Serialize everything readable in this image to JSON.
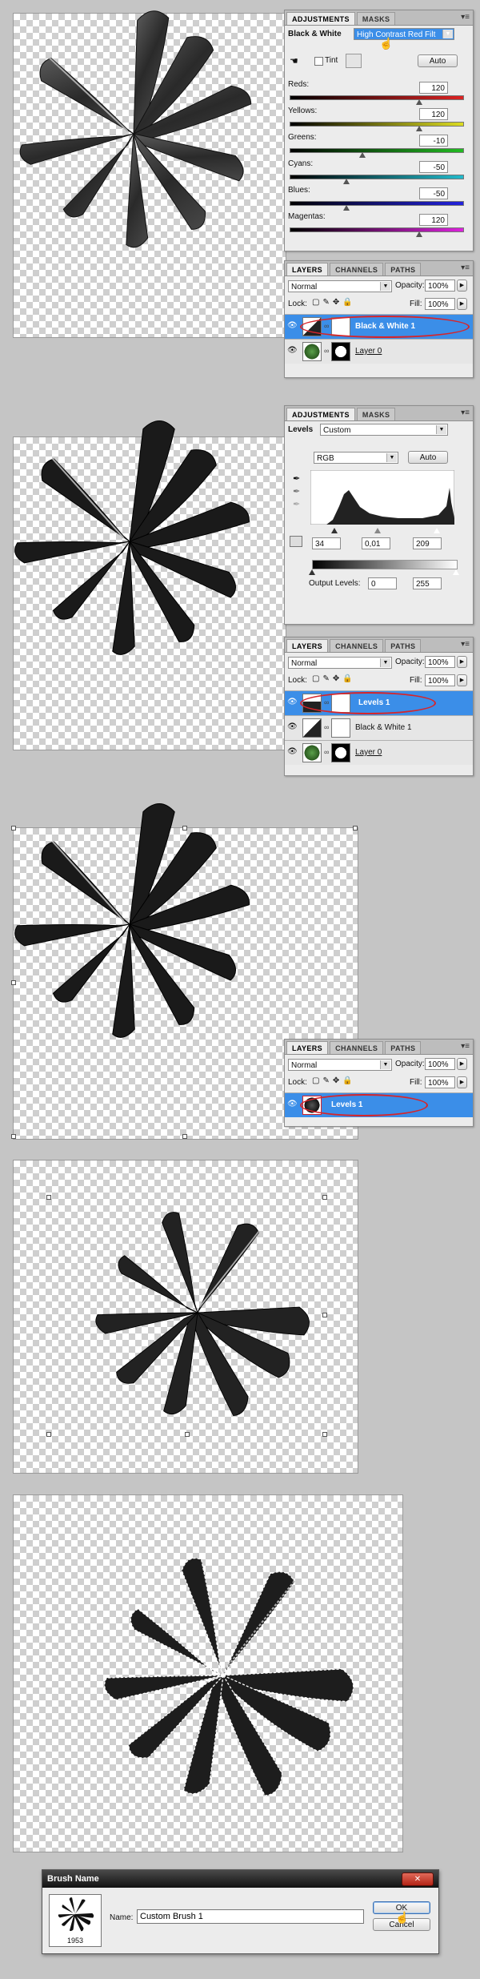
{
  "step1": {
    "adjust_tabs": [
      "ADJUSTMENTS",
      "MASKS"
    ],
    "bw_title": "Black & White",
    "preset": "High Contrast Red Filt",
    "tint_label": "Tint",
    "auto_label": "Auto",
    "sliders": [
      {
        "label": "Reds:",
        "value": "120",
        "pos": 0.75
      },
      {
        "label": "Yellows:",
        "value": "120",
        "pos": 0.75
      },
      {
        "label": "Greens:",
        "value": "-10",
        "pos": 0.42
      },
      {
        "label": "Cyans:",
        "value": "-50",
        "pos": 0.33
      },
      {
        "label": "Blues:",
        "value": "-50",
        "pos": 0.33
      },
      {
        "label": "Magentas:",
        "value": "120",
        "pos": 0.75
      }
    ],
    "layers_tabs": [
      "LAYERS",
      "CHANNELS",
      "PATHS"
    ],
    "blend": "Normal",
    "opacity_label": "Opacity:",
    "opacity": "100%",
    "lock_label": "Lock:",
    "fill_label": "Fill:",
    "fill": "100%",
    "layers": [
      {
        "name": "Black & White 1",
        "selected": true
      },
      {
        "name": "Layer 0",
        "selected": false
      }
    ]
  },
  "step2": {
    "adjust_tabs": [
      "ADJUSTMENTS",
      "MASKS"
    ],
    "levels_title": "Levels",
    "preset": "Custom",
    "channel": "RGB",
    "auto_label": "Auto",
    "input": [
      "34",
      "0,01",
      "209"
    ],
    "output_label": "Output Levels:",
    "output": [
      "0",
      "255"
    ],
    "layers_tabs": [
      "LAYERS",
      "CHANNELS",
      "PATHS"
    ],
    "blend": "Normal",
    "opacity_label": "Opacity:",
    "opacity": "100%",
    "lock_label": "Lock:",
    "fill_label": "Fill:",
    "fill": "100%",
    "layers": [
      {
        "name": "Levels 1",
        "selected": true
      },
      {
        "name": "Black & White 1",
        "selected": false
      },
      {
        "name": "Layer 0",
        "selected": false
      }
    ]
  },
  "step3": {
    "layers_tabs": [
      "LAYERS",
      "CHANNELS",
      "PATHS"
    ],
    "blend": "Normal",
    "opacity_label": "Opacity:",
    "opacity": "100%",
    "lock_label": "Lock:",
    "fill_label": "Fill:",
    "fill": "100%",
    "layers": [
      {
        "name": "Levels 1",
        "selected": true
      }
    ]
  },
  "dialog": {
    "title": "Brush Name",
    "size": "1953",
    "name_label": "Name:",
    "name_value": "Custom Brush 1",
    "ok_label": "OK",
    "cancel_label": "Cancel",
    "close_glyph": "✕"
  },
  "colors": {
    "selection_blue": "#3b8ee8",
    "annotation_red": "#d6252a"
  }
}
